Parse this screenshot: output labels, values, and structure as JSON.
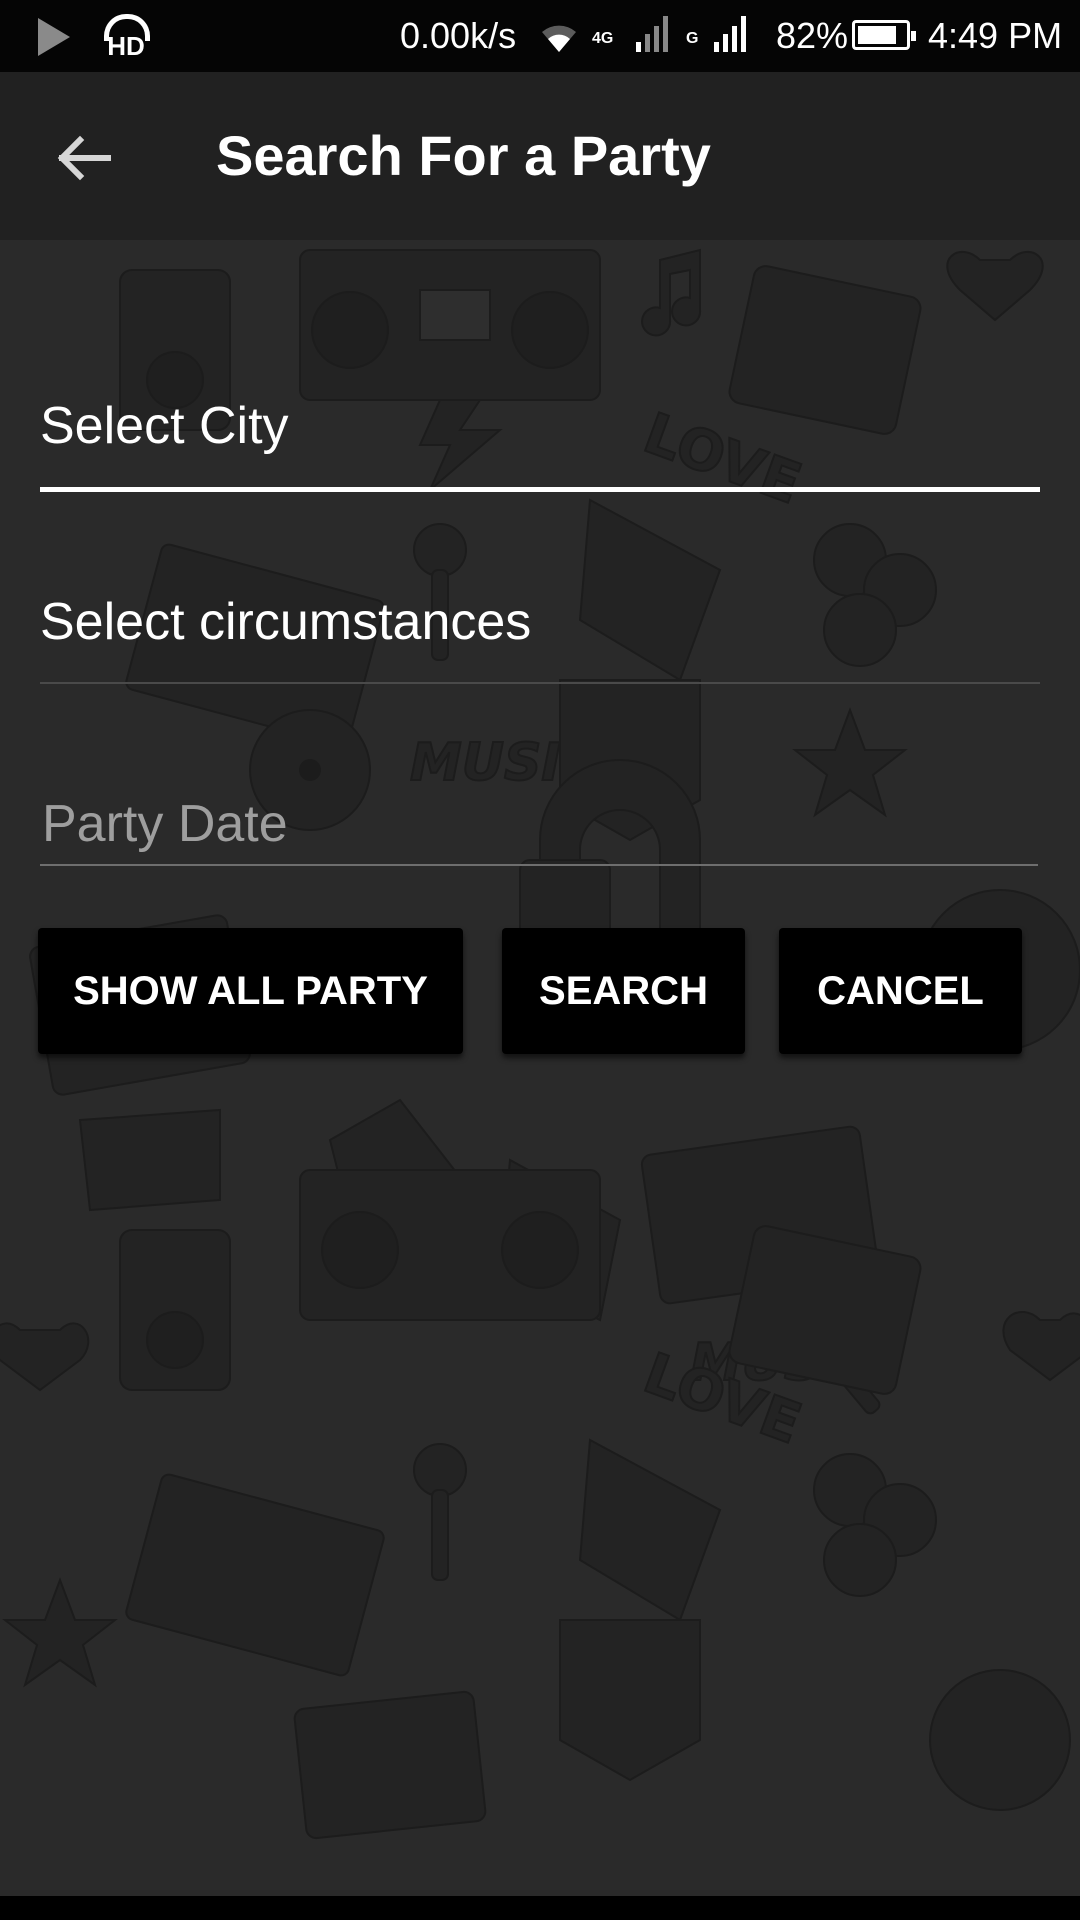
{
  "status_bar": {
    "network_speed": "0.00k/s",
    "network_4g_label": "4G",
    "network_g_label": "G",
    "battery_percent": "82%",
    "battery_level": 0.82,
    "time": "4:49 PM",
    "icons": [
      "play-icon",
      "hd-headset-icon",
      "wifi-icon",
      "signal-icon",
      "signal-icon",
      "battery-icon"
    ]
  },
  "app_bar": {
    "back_icon": "arrow-left-icon",
    "title": "Search For a Party"
  },
  "form": {
    "city_select": "Select City",
    "circumstances_select": "Select circumstances",
    "party_date_placeholder": "Party Date",
    "party_date_value": ""
  },
  "actions": {
    "show_all_label": "SHOW ALL PARTY",
    "search_label": "SEARCH",
    "cancel_label": "CANCEL"
  },
  "colors": {
    "app_bar": "#212121",
    "background": "#2a2a2a",
    "button": "#000000",
    "text": "#ffffff",
    "hint": "#9e9e9e"
  }
}
